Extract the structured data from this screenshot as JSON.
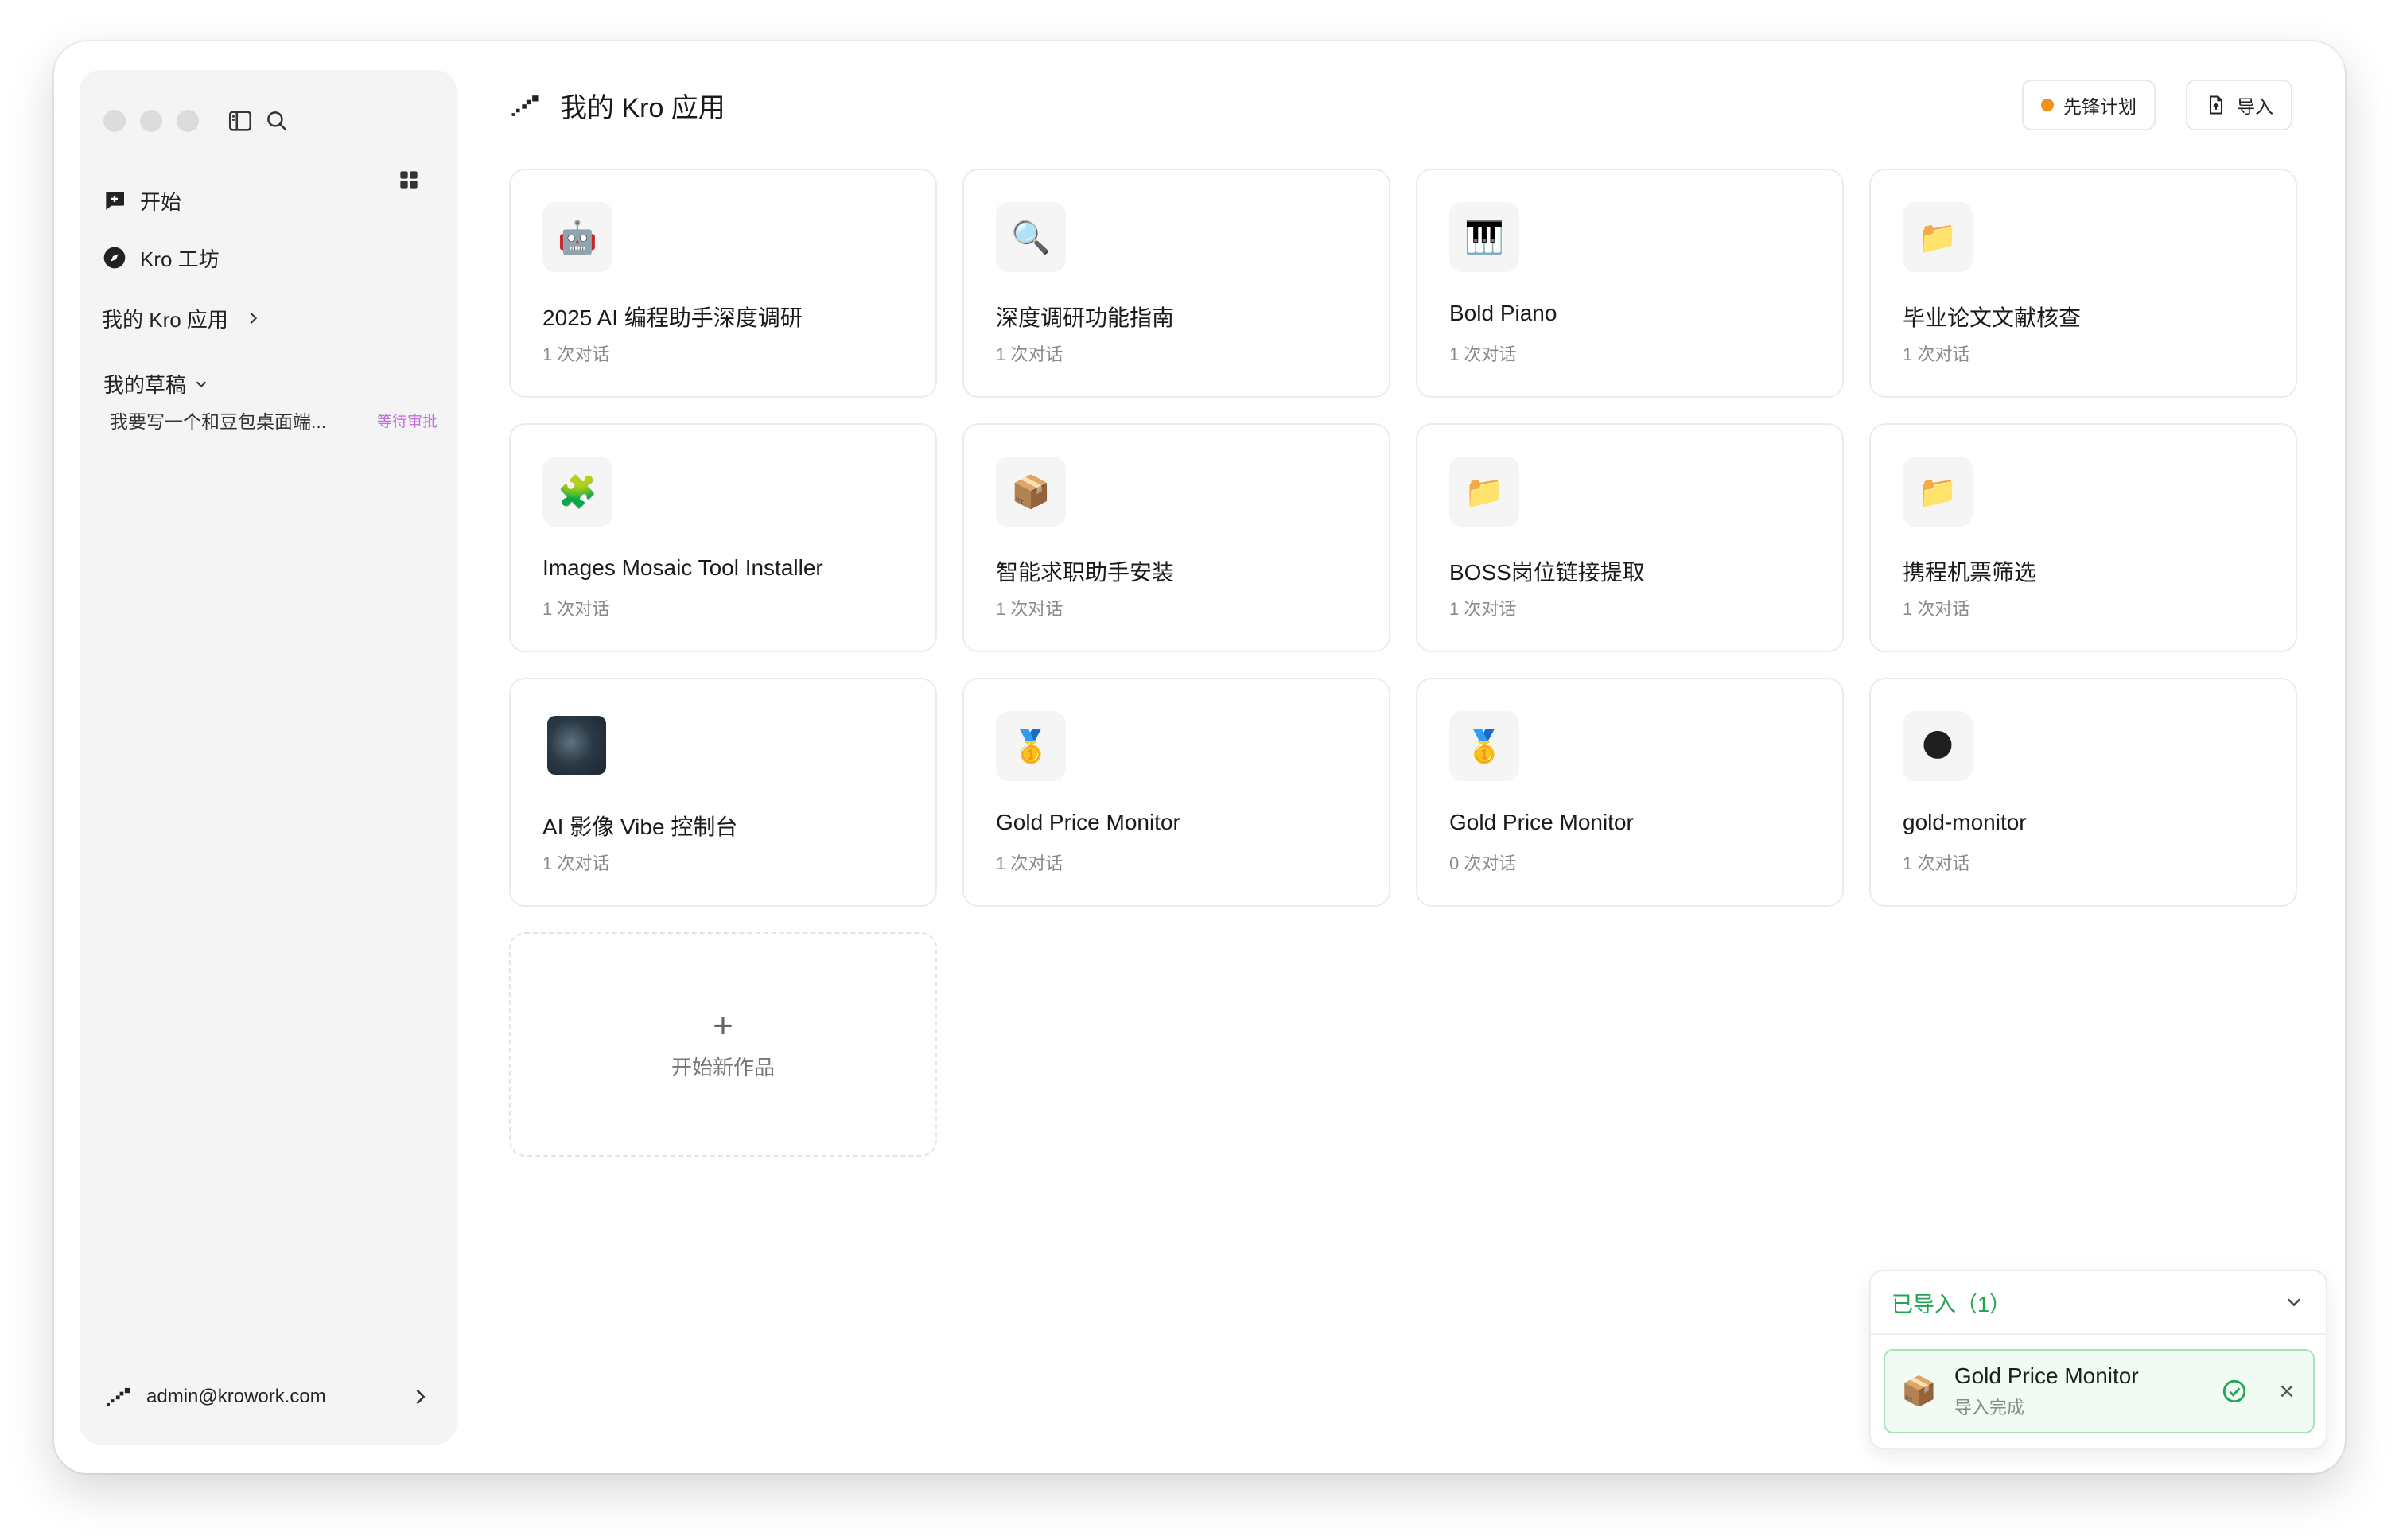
{
  "sidebar": {
    "nav": {
      "start": "开始",
      "workshop": "Kro 工坊",
      "my_apps": "我的 Kro 应用"
    },
    "drafts_label": "我的草稿",
    "drafts": [
      {
        "title": "我要写一个和豆包桌面端...",
        "status": "等待审批"
      }
    ],
    "user_email": "admin@krowork.com"
  },
  "header": {
    "title": "我的 Kro 应用",
    "pioneer_button": "先锋计划",
    "import_button": "导入"
  },
  "apps": [
    {
      "icon": "robot-icon",
      "emoji": "🤖",
      "name": "2025 AI 编程助手深度调研",
      "conversations": "1 次对话"
    },
    {
      "icon": "magnifier-icon",
      "emoji": "🔍",
      "name": "深度调研功能指南",
      "conversations": "1 次对话"
    },
    {
      "icon": "piano-icon",
      "emoji": "🎹",
      "name": "Bold Piano",
      "conversations": "1 次对话"
    },
    {
      "icon": "folder-icon",
      "emoji": "📁",
      "name": "毕业论文文献核查",
      "conversations": "1 次对话"
    },
    {
      "icon": "puzzle-icon",
      "emoji": "🧩",
      "name": "Images Mosaic Tool Installer",
      "conversations": "1 次对话"
    },
    {
      "icon": "package-icon",
      "emoji": "📦",
      "name": "智能求职助手安装",
      "conversations": "1 次对话"
    },
    {
      "icon": "folder-icon",
      "emoji": "📁",
      "name": "BOSS岗位链接提取",
      "conversations": "1 次对话"
    },
    {
      "icon": "folder-icon",
      "emoji": "📁",
      "name": "携程机票筛选",
      "conversations": "1 次对话"
    },
    {
      "icon": "image-thumbnail",
      "emoji": "",
      "name": "AI 影像 Vibe 控制台",
      "conversations": "1 次对话"
    },
    {
      "icon": "medal-icon",
      "emoji": "🥇",
      "name": "Gold Price Monitor",
      "conversations": "1 次对话"
    },
    {
      "icon": "medal-icon",
      "emoji": "🥇",
      "name": "Gold Price Monitor",
      "conversations": "0 次对话"
    },
    {
      "icon": "moon-icon",
      "emoji": "🌑",
      "name": "gold-monitor",
      "conversations": "1 次对话"
    }
  ],
  "new_app": {
    "plus": "+",
    "label": "开始新作品"
  },
  "import_panel": {
    "title": "已导入（1）",
    "item": {
      "emoji": "📦",
      "name": "Gold Price Monitor",
      "status": "导入完成"
    }
  },
  "colors": {
    "accent_orange": "#f39018",
    "success_green": "#23a455",
    "draft_status": "#c56ee0"
  }
}
